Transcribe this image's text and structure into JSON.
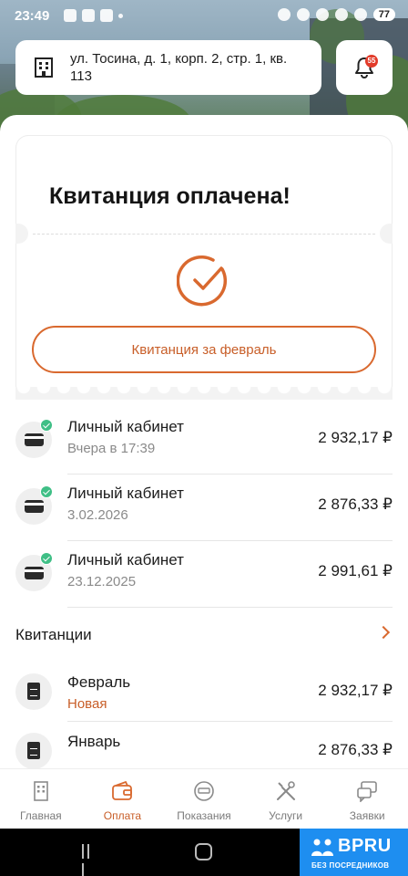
{
  "status_bar": {
    "time": "23:49",
    "battery": "77"
  },
  "header": {
    "address": "ул. Тосина, д. 1, корп. 2, стр. 1, кв. 113",
    "notifications_badge": "55"
  },
  "receipt": {
    "title": "Квитанция оплачена!",
    "button_label": "Квитанция за февраль"
  },
  "payments": [
    {
      "name": "Личный кабинет",
      "date": "Вчера в 17:39",
      "amount": "2 932,17 ₽"
    },
    {
      "name": "Личный кабинет",
      "date": "3.02.2026",
      "amount": "2 876,33 ₽"
    },
    {
      "name": "Личный кабинет",
      "date": "23.12.2025",
      "amount": "2 991,61 ₽"
    }
  ],
  "invoices_section": {
    "title": "Квитанции"
  },
  "invoices": [
    {
      "month": "Февраль",
      "status": "Новая",
      "amount": "2 932,17 ₽"
    },
    {
      "month": "Январь",
      "status": "",
      "amount": "2 876,33 ₽"
    }
  ],
  "tabs": [
    {
      "label": "Главная",
      "icon": "building-icon"
    },
    {
      "label": "Оплата",
      "icon": "wallet-icon",
      "active": true
    },
    {
      "label": "Показания",
      "icon": "meter-icon"
    },
    {
      "label": "Услуги",
      "icon": "tools-icon"
    },
    {
      "label": "Заявки",
      "icon": "chat-icon"
    }
  ],
  "watermark": {
    "brand": "BPRU",
    "tagline": "БЕЗ ПОСРЕДНИКОВ"
  },
  "colors": {
    "accent": "#d9692f",
    "success": "#3fbf86",
    "badge": "#e23b2a",
    "watermark_bg": "#1e8ef0"
  }
}
